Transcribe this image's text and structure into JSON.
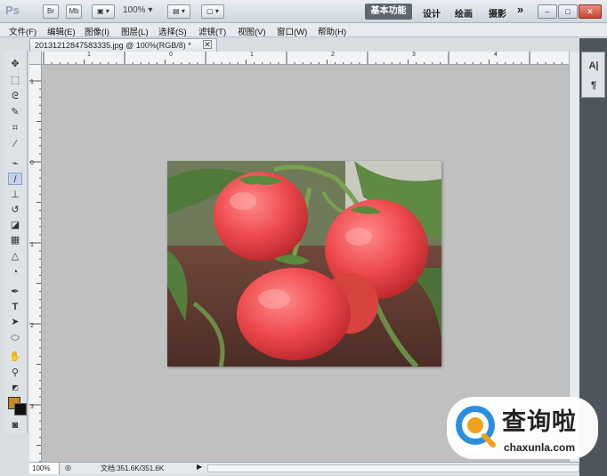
{
  "app": {
    "logo": "Ps",
    "zoom_select": "100%",
    "workspaces": {
      "active": "基本功能",
      "items": [
        "设计",
        "绘画",
        "摄影"
      ],
      "more": "»"
    },
    "window_buttons": [
      "–",
      "□",
      "✕"
    ]
  },
  "menu": {
    "items": [
      "文件(F)",
      "编辑(E)",
      "图像(I)",
      "图层(L)",
      "选择(S)",
      "滤镜(T)",
      "视图(V)",
      "窗口(W)",
      "帮助(H)"
    ]
  },
  "document": {
    "tab_title": "20131212847583335.jpg @ 100%(RGB/8) *",
    "tab_close": "✕",
    "ruler_top_labels": [
      "1",
      "0",
      "1",
      "2",
      "3",
      "4"
    ],
    "ruler_left_labels": [
      "1",
      "0",
      "1",
      "2",
      "3"
    ],
    "photo_icon": "tomato-photo"
  },
  "status": {
    "zoom": "100%",
    "doc_info": "文档:351.6K/351.6K",
    "arrow": "▶"
  },
  "tools": [
    "move-icon",
    "marquee-icon",
    "lasso-icon",
    "quick-select-icon",
    "crop-icon",
    "eyedropper-icon",
    "healing-brush-icon",
    "brush-icon",
    "clone-stamp-icon",
    "history-brush-icon",
    "eraser-icon",
    "gradient-icon",
    "blur-icon",
    "dodge-icon",
    "pen-icon",
    "type-icon",
    "path-select-icon",
    "shape-icon",
    "hand-icon",
    "zoom-icon"
  ],
  "colors": {
    "foreground": "#c88a21",
    "background": "#111111",
    "accent_active_workspace": "#5f6770"
  },
  "watermark": {
    "title": "查询啦",
    "site": "chaxunla.com"
  }
}
